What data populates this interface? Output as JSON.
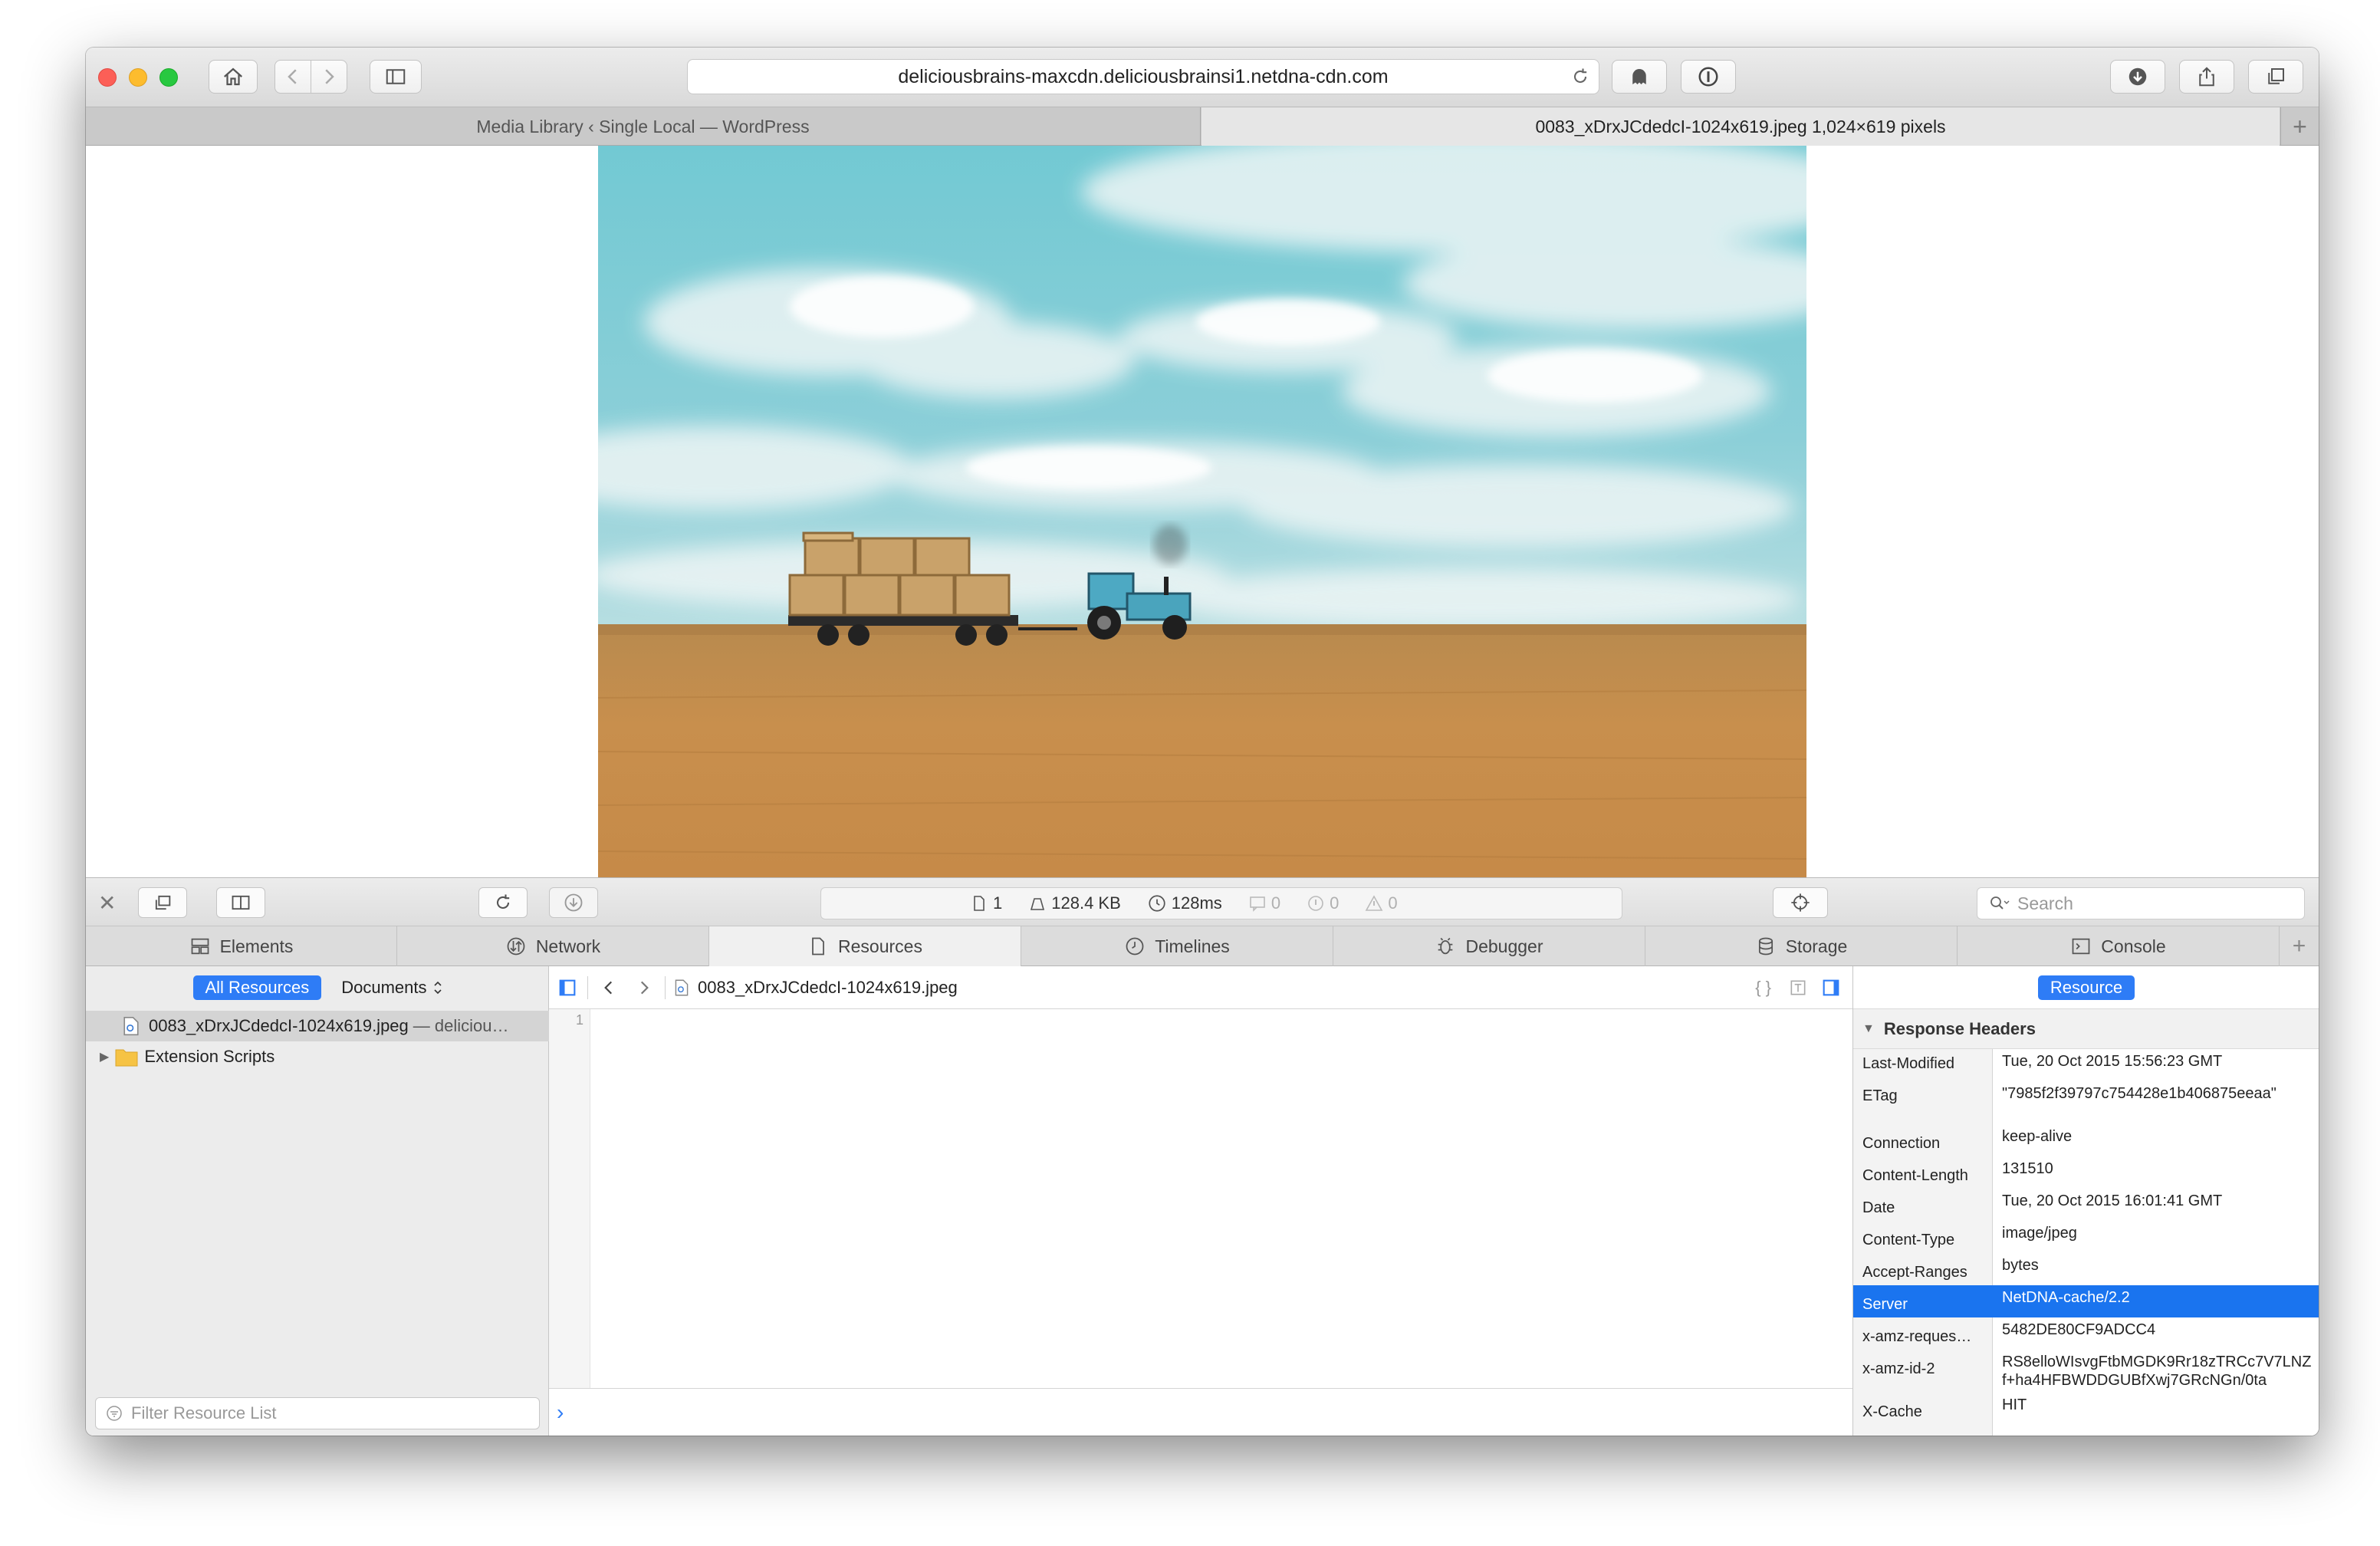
{
  "browser": {
    "url": "deliciousbrains-maxcdn.deliciousbrainsi1.netdna-cdn.com",
    "tabs": [
      {
        "label": "Media Library ‹ Single Local — WordPress",
        "active": false
      },
      {
        "label": "0083_xDrxJCdedcI-1024x619.jpeg 1,024×619 pixels",
        "active": true
      }
    ],
    "icons": [
      "home-icon",
      "back-icon",
      "forward-icon",
      "sidebar-icon",
      "reload-icon",
      "ghostery-icon",
      "onepassword-icon",
      "downloads-icon",
      "share-icon",
      "tabs-overview-icon",
      "new-tab-icon"
    ]
  },
  "devtools": {
    "stats": {
      "resources": "1",
      "size": "128.4 KB",
      "time": "128ms",
      "logs": "0",
      "errors": "0",
      "warnings": "0"
    },
    "search_placeholder": "Search",
    "tabs": [
      {
        "label": "Elements",
        "icon": "elements-icon"
      },
      {
        "label": "Network",
        "icon": "network-icon"
      },
      {
        "label": "Resources",
        "icon": "resources-icon",
        "active": true
      },
      {
        "label": "Timelines",
        "icon": "timelines-icon"
      },
      {
        "label": "Debugger",
        "icon": "debugger-icon"
      },
      {
        "label": "Storage",
        "icon": "storage-icon"
      },
      {
        "label": "Console",
        "icon": "console-icon"
      }
    ],
    "left": {
      "scope_all": "All Resources",
      "scope_docs": "Documents",
      "tree": [
        {
          "label": "0083_xDrxJCdedcI-1024x619.jpeg",
          "detail": "— deliciou…",
          "selected": true
        },
        {
          "label": "Extension Scripts",
          "selected": false
        }
      ],
      "filter_placeholder": "Filter Resource List"
    },
    "center": {
      "filename": "0083_xDrxJCdedcI-1024x619.jpeg",
      "line_number": "1"
    },
    "right": {
      "tab": "Resource",
      "section": "Response Headers",
      "headers": [
        {
          "key": "Last-Modified",
          "value": "Tue, 20 Oct 2015 15:56:23 GMT"
        },
        {
          "key": "ETag",
          "value": "\"7985f2f39797c754428e1b406875eeaa\""
        },
        {
          "key": "Connection",
          "value": "keep-alive"
        },
        {
          "key": "Content-Length",
          "value": "131510"
        },
        {
          "key": "Date",
          "value": "Tue, 20 Oct 2015 16:01:41 GMT"
        },
        {
          "key": "Content-Type",
          "value": "image/jpeg"
        },
        {
          "key": "Accept-Ranges",
          "value": "bytes"
        },
        {
          "key": "Server",
          "value": "NetDNA-cache/2.2",
          "selected": true
        },
        {
          "key": "x-amz-reques…",
          "value": "5482DE80CF9ADCC4"
        },
        {
          "key": "x-amz-id-2",
          "value": "RS8elloWIsvgFtbMGDK9Rr18zTRCc7V7LNZf+ha4HFBWDDGUBfXwj7GRcNGn/0ta"
        },
        {
          "key": "X-Cache",
          "value": "HIT"
        }
      ]
    }
  },
  "colors": {
    "accent": "#2e7cf6",
    "selection": "#1a74ef"
  }
}
